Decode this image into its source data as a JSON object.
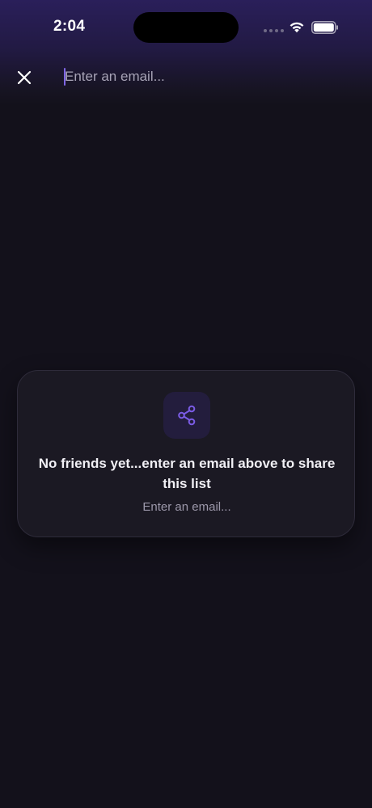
{
  "status_bar": {
    "time": "2:04"
  },
  "header": {
    "close_icon": "close-icon",
    "email_input": {
      "value": "",
      "placeholder": "Enter an email..."
    }
  },
  "empty_state": {
    "icon": "share-icon",
    "title": "No friends yet...enter an email above to share this list",
    "subtitle": "Enter an email..."
  },
  "colors": {
    "background": "#13111b",
    "accent": "#7f66e6",
    "card": "#1b1923"
  }
}
